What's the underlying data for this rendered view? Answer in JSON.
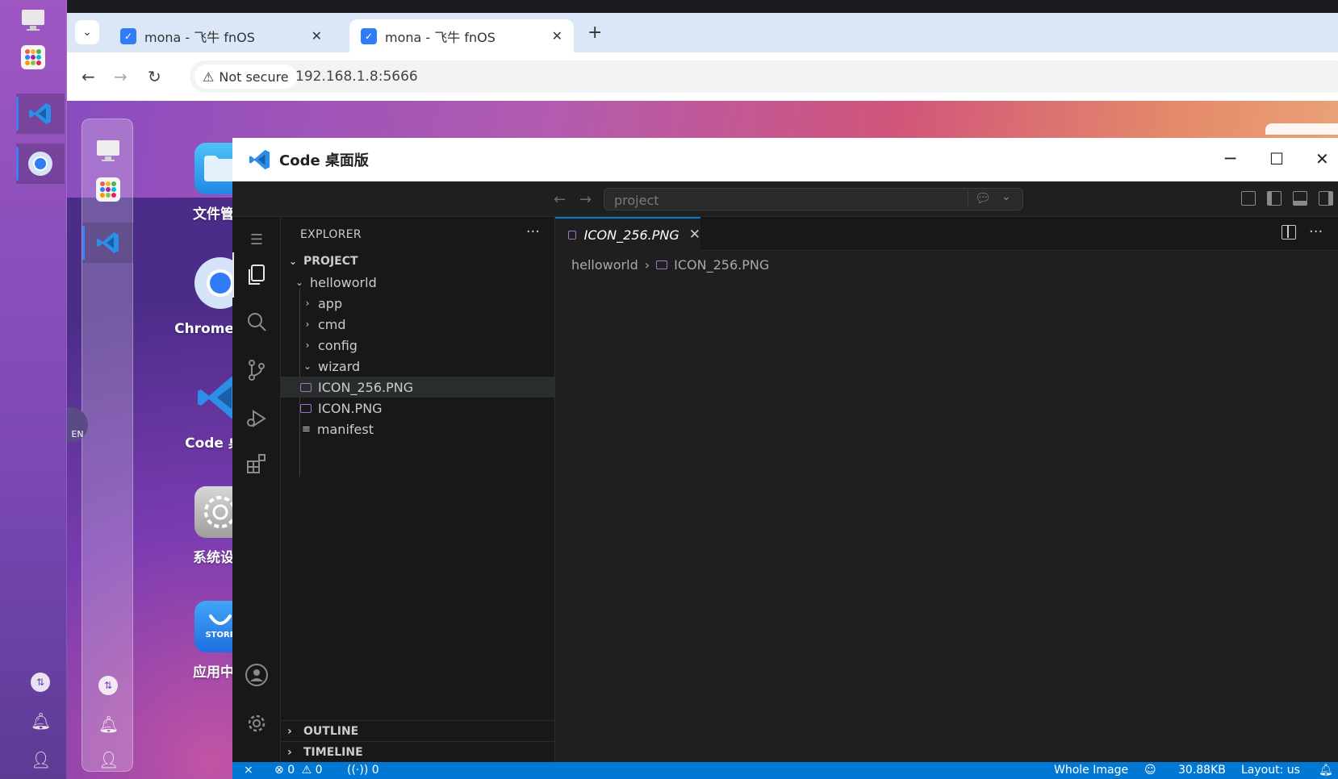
{
  "browser": {
    "tabs": [
      {
        "title": "mona - 飞牛 fnOS",
        "close": "✕"
      },
      {
        "title": "mona - 飞牛 fnOS",
        "close": "✕"
      }
    ],
    "new_tab": "+",
    "not_secure": "Not secure",
    "url": "192.168.1.8:5666"
  },
  "fnos": {
    "desktop_icons": [
      {
        "label": "文件管理"
      },
      {
        "label": "Chrome 浏览"
      },
      {
        "label": "Code 桌面"
      },
      {
        "label": "系统设置"
      },
      {
        "label": "应用中心"
      }
    ],
    "store_text": "STORE",
    "lang_badge": "EN"
  },
  "vscode": {
    "window_title": "Code 桌面版",
    "search_placeholder": "project",
    "explorer_header": "EXPLORER",
    "more": "···",
    "tree": {
      "root": "PROJECT",
      "folder": "helloworld",
      "items": [
        "app",
        "cmd",
        "config",
        "wizard"
      ],
      "wizard_files": [
        "ICON_256.PNG",
        "ICON.PNG",
        "manifest"
      ]
    },
    "sections": {
      "outline": "OUTLINE",
      "timeline": "TIMELINE"
    },
    "editor_tab": "ICON_256.PNG",
    "breadcrumb": {
      "folder": "helloworld",
      "sep": "›",
      "file": "ICON_256.PNG"
    },
    "status": {
      "errors": "0",
      "warnings": "0",
      "ports": "0",
      "image_mode": "Whole Image",
      "size": "30.88KB",
      "layout": "Layout: us"
    }
  },
  "colors": {
    "accent": "#0078d4",
    "status_bar": "#0078d4",
    "vscode_bg": "#1e1e1e",
    "sidebar_bg": "#181818"
  }
}
